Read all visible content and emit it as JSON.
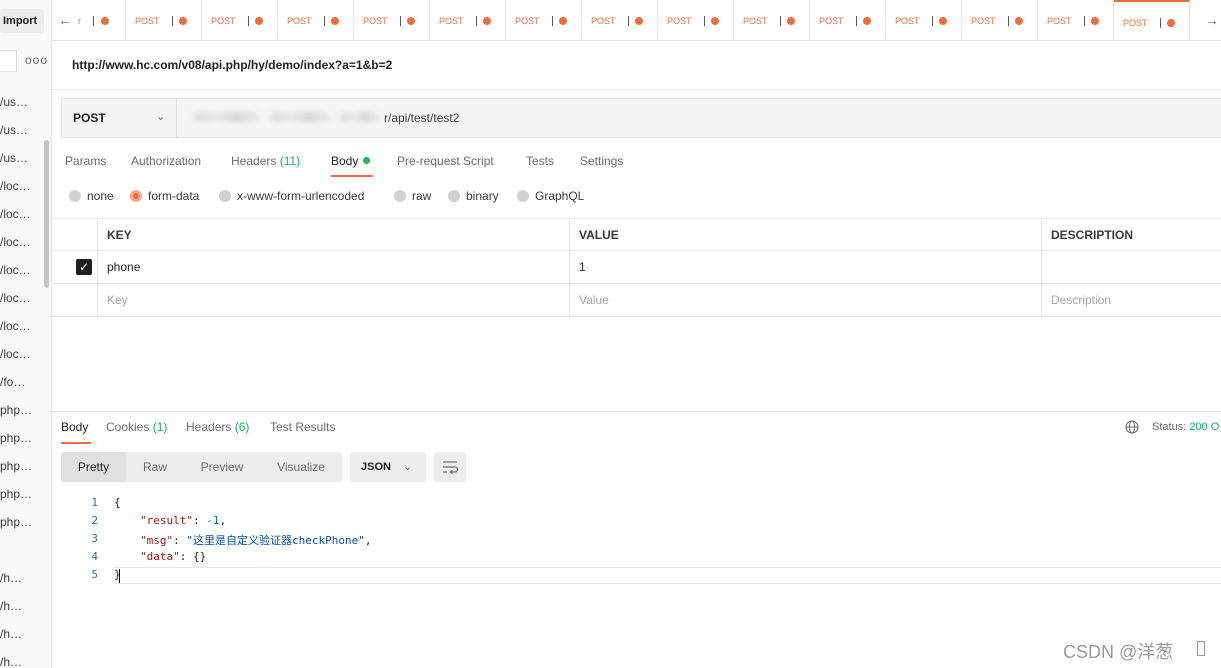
{
  "sidebar": {
    "import_label": "Import",
    "more_label": "ooo",
    "items": [
      "/us…",
      "/us…",
      "/us…",
      "/loc…",
      "/loc…",
      "/loc…",
      "/loc…",
      "/loc…",
      "/loc…",
      "/loc…",
      "/fo…",
      "php…",
      "php…",
      "php…",
      "php…",
      "php…",
      "",
      "/h…",
      "/h…",
      "/h…",
      "/h…"
    ]
  },
  "tabbar": {
    "back_icon": "arrow-left-icon",
    "forward_icon": "arrow-right-icon",
    "tabs": [
      {
        "method": "r"
      },
      {
        "method": "POST"
      },
      {
        "method": "POST"
      },
      {
        "method": "POST"
      },
      {
        "method": "POST"
      },
      {
        "method": "POST"
      },
      {
        "method": "POST"
      },
      {
        "method": "POST"
      },
      {
        "method": "POST"
      },
      {
        "method": "POST"
      },
      {
        "method": "POST"
      },
      {
        "method": "POST"
      },
      {
        "method": "POST"
      },
      {
        "method": "POST"
      },
      {
        "method": "POST"
      }
    ],
    "accent": "#f26b3a"
  },
  "request": {
    "title_url": "http://www.hc.com/v08/api.php/hy/demo/index?a=1&b=2",
    "method": "POST",
    "url_visible": "r/api/test/test2"
  },
  "request_tabs": {
    "params": "Params",
    "authorization": "Authorization",
    "headers": "Headers",
    "headers_count": "(11)",
    "body": "Body",
    "prerequest": "Pre-request Script",
    "tests": "Tests",
    "settings": "Settings"
  },
  "body_types": [
    "none",
    "form-data",
    "x-www-form-urlencoded",
    "raw",
    "binary",
    "GraphQL"
  ],
  "body_type_selected": "form-data",
  "form_table": {
    "headers": {
      "key": "KEY",
      "value": "VALUE",
      "description": "DESCRIPTION"
    },
    "rows": [
      {
        "checked": true,
        "key": "phone",
        "value": "1",
        "description": ""
      }
    ],
    "placeholders": {
      "key": "Key",
      "value": "Value",
      "description": "Description"
    }
  },
  "response_tabs": {
    "body": "Body",
    "cookies": "Cookies",
    "cookies_count": "(1)",
    "headers": "Headers",
    "headers_count": "(6)",
    "test_results": "Test Results"
  },
  "status": {
    "label": "Status:",
    "value": "200 O"
  },
  "format": {
    "modes": [
      "Pretty",
      "Raw",
      "Preview",
      "Visualize"
    ],
    "selected": "Pretty",
    "language": "JSON"
  },
  "code": {
    "line_numbers": [
      "1",
      "2",
      "3",
      "4",
      "5"
    ],
    "open_brace": "{",
    "close_brace": "}",
    "result_key": "\"result\"",
    "result_value": "-1",
    "msg_key": "\"msg\"",
    "msg_value": "\"这里是自定义验证器checkPhone\"",
    "data_key": "\"data\"",
    "data_value": "{}",
    "colon": ": ",
    "comma": ","
  },
  "watermark": "CSDN @洋葱",
  "colors": {
    "accent": "#f26b3a",
    "success": "#0cbb52",
    "link": "#2d6db4"
  }
}
